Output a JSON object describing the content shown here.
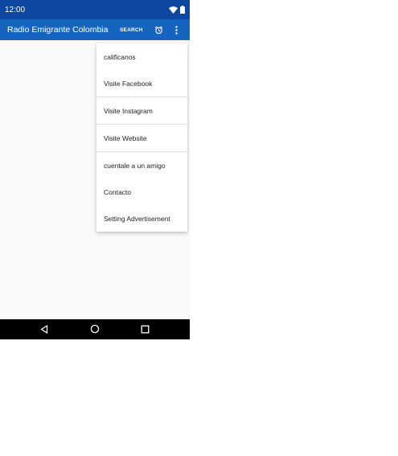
{
  "status_bar": {
    "time": "12:00",
    "icons": [
      "wifi-icon",
      "battery-icon"
    ]
  },
  "app_bar": {
    "title": "Radio Emigrante Colombia",
    "search_label": "SEARCH",
    "alarm_icon": "alarm-icon",
    "overflow_icon": "more-vert-icon"
  },
  "menu": {
    "items": [
      {
        "label": "calificanos",
        "divider_after": false
      },
      {
        "label": "Visite Facebook",
        "divider_after": true
      },
      {
        "label": "Visite Instagram",
        "divider_after": true
      },
      {
        "label": "Visite Website",
        "divider_after": true
      },
      {
        "label": "cuentale a un amigo",
        "divider_after": false
      },
      {
        "label": "Contacto",
        "divider_after": false
      },
      {
        "label": "Setting Advertisement",
        "divider_after": false
      }
    ]
  },
  "nav_bar": {
    "icons": [
      "back-icon",
      "home-icon",
      "recents-icon"
    ]
  },
  "colors": {
    "status_bar": "#0d47a1",
    "app_bar": "#1565c0",
    "background": "#fafafa",
    "nav_bar": "#000000"
  }
}
